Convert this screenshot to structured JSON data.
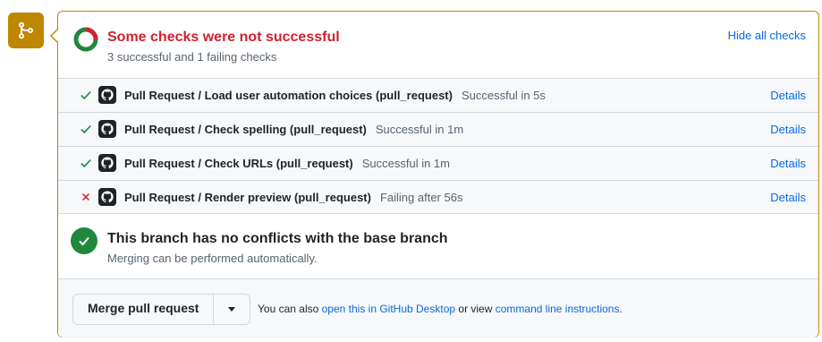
{
  "badge": {
    "icon": "git-merge-icon",
    "color": "#bf8700"
  },
  "header": {
    "title": "Some checks were not successful",
    "subtitle": "3 successful and 1 failing checks",
    "hide_link": "Hide all checks"
  },
  "checks": [
    {
      "name": "Pull Request / Load user automation choices (pull_request)",
      "status": "Successful in 5s",
      "result": "success",
      "details": "Details"
    },
    {
      "name": "Pull Request / Check spelling (pull_request)",
      "status": "Successful in 1m",
      "result": "success",
      "details": "Details"
    },
    {
      "name": "Pull Request / Check URLs (pull_request)",
      "status": "Successful in 1m",
      "result": "success",
      "details": "Details"
    },
    {
      "name": "Pull Request / Render preview (pull_request)",
      "status": "Failing after 56s",
      "result": "failure",
      "details": "Details"
    }
  ],
  "conflict": {
    "title": "This branch has no conflicts with the base branch",
    "subtitle": "Merging can be performed automatically."
  },
  "footer": {
    "merge_button": "Merge pull request",
    "text_prefix": "You can also",
    "link_desktop": "open this in GitHub Desktop",
    "text_middle": "or view",
    "link_cli": "command line instructions",
    "text_suffix": "."
  },
  "colors": {
    "success": "#1f883d",
    "failure": "#cf222e",
    "link": "#0969da",
    "warning": "#bf8700"
  }
}
